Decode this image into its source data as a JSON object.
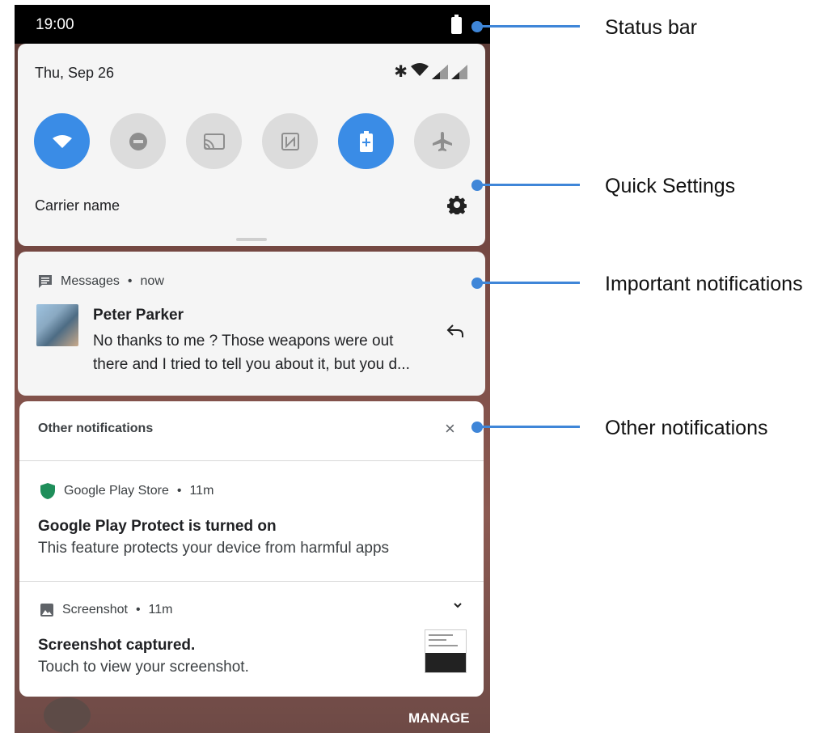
{
  "status_bar": {
    "time": "19:00"
  },
  "quick_settings": {
    "date": "Thu, Sep 26",
    "carrier": "Carrier name",
    "tiles": [
      {
        "name": "wifi",
        "on": true
      },
      {
        "name": "do-not-disturb",
        "on": false
      },
      {
        "name": "cast",
        "on": false
      },
      {
        "name": "nfc",
        "on": false
      },
      {
        "name": "battery-saver",
        "on": true
      },
      {
        "name": "airplane-mode",
        "on": false
      }
    ]
  },
  "important": {
    "app_name": "Messages",
    "time": "now",
    "sender": "Peter Parker",
    "body": "No thanks to me ? Those weapons were out there and I tried  to  tell you about it, but you d..."
  },
  "other": {
    "header": "Other notifications",
    "close_glyph": "×",
    "items": [
      {
        "app_name": "Google Play Store",
        "time": "11m",
        "title": "Google Play Protect is turned on",
        "text": "This feature protects your device from harmful apps"
      },
      {
        "app_name": "Screenshot",
        "time": "11m",
        "title": "Screenshot captured.",
        "text": "Touch to view your screenshot."
      }
    ]
  },
  "dock": {
    "manage_label": "MANAGE"
  },
  "annotations": {
    "status_bar": "Status bar",
    "quick_settings": "Quick Settings",
    "important": "Important notifications",
    "other": "Other notifications"
  },
  "colors": {
    "accent": "#3a8ce6",
    "annotation": "#3f86d8",
    "shield": "#1e8e5a"
  }
}
